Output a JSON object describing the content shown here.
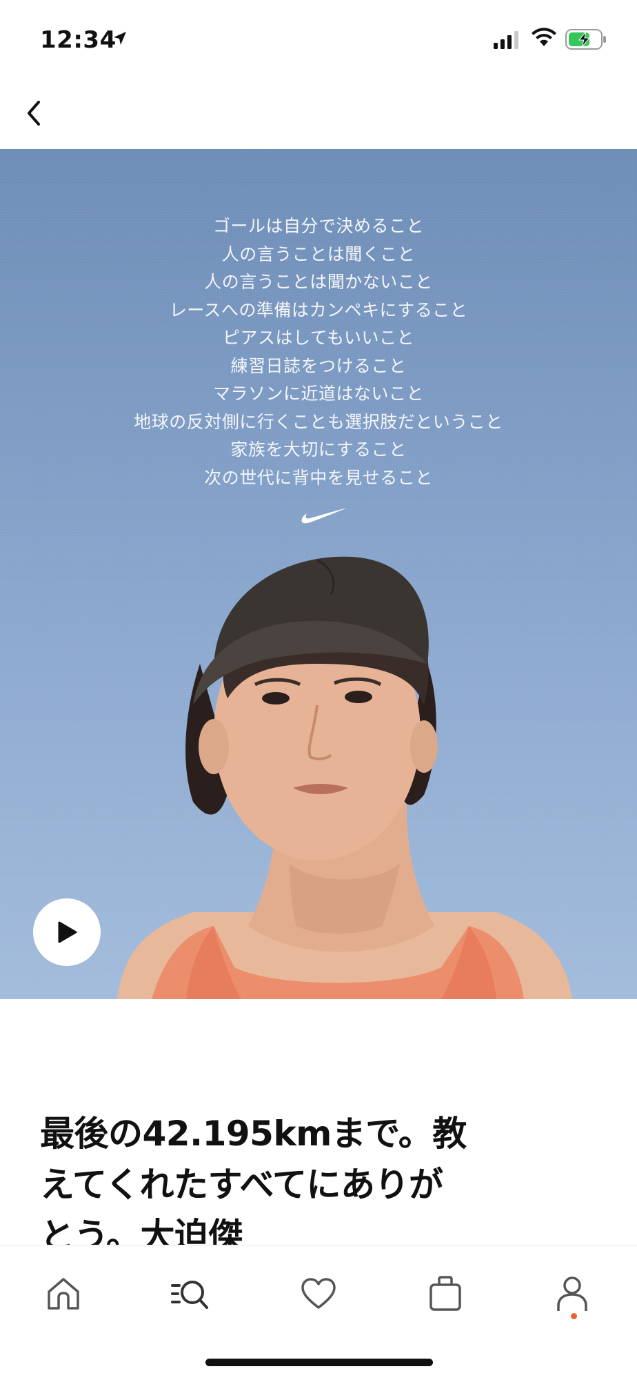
{
  "status_bar": {
    "time": "12:34",
    "battery_color": "#34c759"
  },
  "nav": {
    "back_icon": "chevron-left-icon"
  },
  "hero": {
    "poem_lines": [
      "ゴールは自分で決めること",
      "人の言うことは聞くこと",
      "人の言うことは聞かないこと",
      "レースへの準備はカンペキにすること",
      "ピアスはしてもいいこと",
      "練習日誌をつけること",
      "マラソンに近道はないこと",
      "地球の反対側に行くことも選択肢だということ",
      "家族を大切にすること",
      "次の世代に背中を見せること"
    ],
    "logo": "swoosh-logo",
    "play_icon": "play-icon",
    "sky_color": "#7d9bc3"
  },
  "article": {
    "headline_line1": "最後の42.195kmまで。教",
    "headline_line2": "えてくれたすべてにありが",
    "headline_line3": "とう。大迫傑"
  },
  "tab_bar": {
    "items": [
      {
        "name": "home",
        "icon": "home-icon"
      },
      {
        "name": "discover",
        "icon": "search-list-icon"
      },
      {
        "name": "favorites",
        "icon": "heart-icon"
      },
      {
        "name": "bag",
        "icon": "bag-icon"
      },
      {
        "name": "profile",
        "icon": "user-icon"
      }
    ],
    "notification_color": "#e8612c"
  }
}
